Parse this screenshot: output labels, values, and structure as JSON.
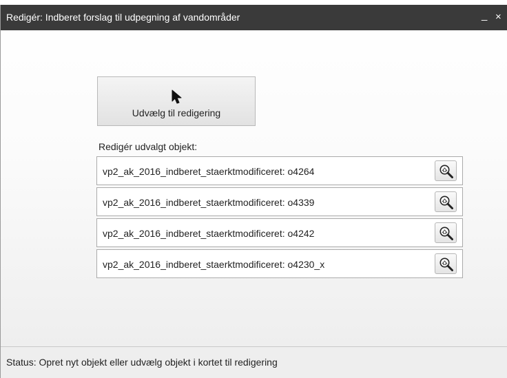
{
  "window": {
    "title": "Redigér: Indberet forslag til udpegning af vandområder",
    "minimize_label": "_",
    "close_label": "×"
  },
  "select_button": {
    "label": "Udvælg til redigering",
    "icon": "cursor-arrow-icon"
  },
  "edit_section": {
    "label": "Redigér udvalgt objekt:",
    "items": [
      {
        "label": "vp2_ak_2016_indberet_staerktmodificeret: o4264",
        "icon": "zoom-icon"
      },
      {
        "label": "vp2_ak_2016_indberet_staerktmodificeret: o4339",
        "icon": "zoom-icon"
      },
      {
        "label": "vp2_ak_2016_indberet_staerktmodificeret: o4242",
        "icon": "zoom-icon"
      },
      {
        "label": "vp2_ak_2016_indberet_staerktmodificeret: o4230_x",
        "icon": "zoom-icon"
      }
    ]
  },
  "status": {
    "text": "Status: Opret nyt objekt eller udvælg objekt i kortet til redigering"
  },
  "colors": {
    "titlebar": "#3a3a3a",
    "title_text": "#ffffff",
    "border": "#aaaaaa"
  }
}
